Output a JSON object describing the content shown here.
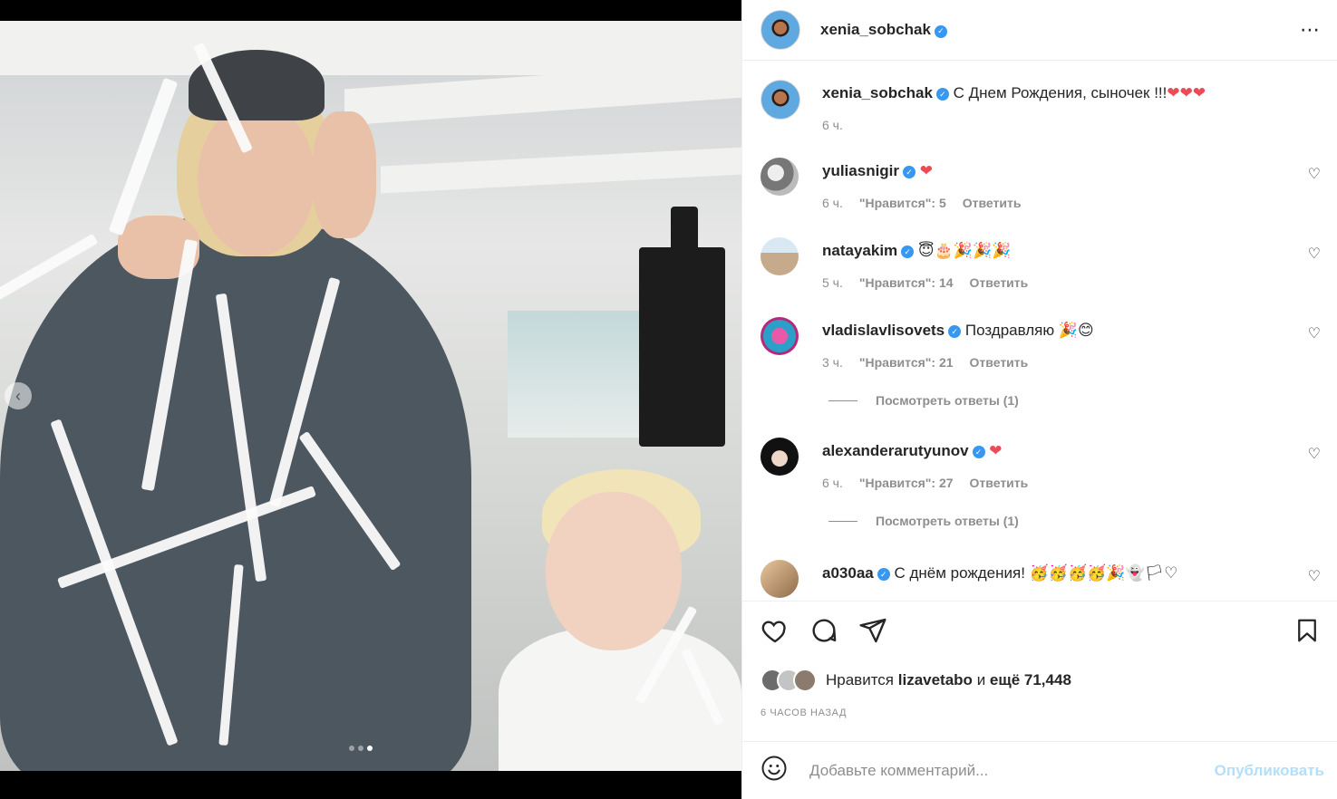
{
  "post": {
    "author": "xenia_sobchak",
    "caption": "С Днем Рождения, сыночек !!!",
    "caption_emoji": "❤❤❤",
    "caption_time": "6 ч.",
    "more_icon": "⋯"
  },
  "comments": [
    {
      "user": "yuliasnigir",
      "text": "",
      "emoji": "❤",
      "time": "6 ч.",
      "likes": "\"Нравится\": 5",
      "reply": "Ответить"
    },
    {
      "user": "natayakim",
      "text": "",
      "emoji": "😇🎂🎉🎉🎉",
      "time": "5 ч.",
      "likes": "\"Нравится\": 14",
      "reply": "Ответить"
    },
    {
      "user": "vladislavlisovets",
      "text": "Поздравляю",
      "emoji": "🎉😊",
      "time": "3 ч.",
      "likes": "\"Нравится\": 21",
      "reply": "Ответить",
      "view_replies": "Посмотреть ответы (1)"
    },
    {
      "user": "alexanderarutyunov",
      "text": "",
      "emoji": "❤",
      "time": "6 ч.",
      "likes": "\"Нравится\": 27",
      "reply": "Ответить",
      "view_replies": "Посмотреть ответы (1)"
    },
    {
      "user": "a030aa",
      "text": "С днём рождения!",
      "emoji": "🥳🥳🥳🥳🎉👻🏳♡"
    }
  ],
  "likes": {
    "prefix": "Нравится",
    "user": "lizavetabo",
    "middle": "и",
    "rest": "ещё 71,448"
  },
  "time_ago": "6 ЧАСОВ НАЗАД",
  "add_comment": {
    "placeholder": "Добавьте комментарий...",
    "publish": "Опубликовать"
  },
  "carousel": {
    "prev_icon": "‹",
    "count": 3,
    "active": 2
  },
  "colors": {
    "verified": "#3897f0",
    "heart_red": "#ed4956",
    "publish_disabled": "#b2dffc",
    "meta_gray": "#8e8e8e"
  }
}
